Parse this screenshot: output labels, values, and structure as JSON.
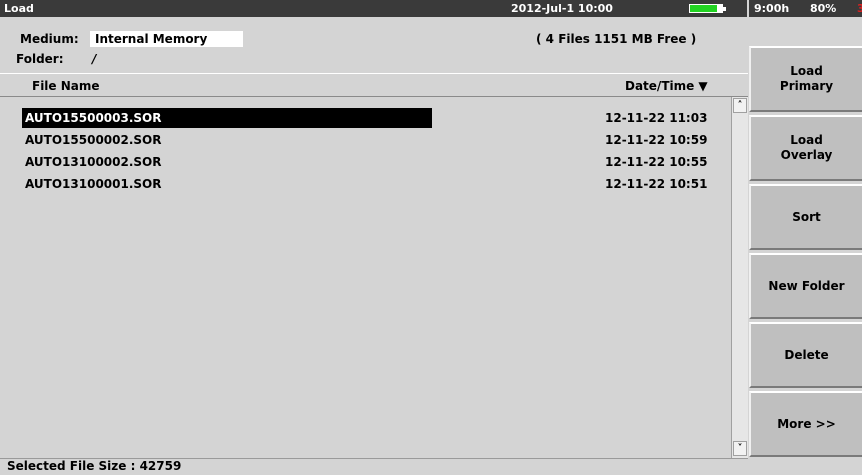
{
  "titlebar": {
    "title": "Load",
    "datetime": "2012-Jul-1 10:00",
    "battery_level": 0.85,
    "battery_color": "#22d322",
    "runtime": "9:00h",
    "percent": "80%"
  },
  "info": {
    "medium_label": "Medium:",
    "medium_value": "Internal Memory",
    "folder_label": "Folder:",
    "folder_value": "/",
    "summary": "( 4 Files   1151 MB Free )"
  },
  "columns": {
    "name": "File Name",
    "date": "Date/Time ▼"
  },
  "files": [
    {
      "name": "AUTO15500003.SOR",
      "date": "12-11-22 11:03",
      "selected": true
    },
    {
      "name": "AUTO15500002.SOR",
      "date": "12-11-22 10:59",
      "selected": false
    },
    {
      "name": "AUTO13100002.SOR",
      "date": "12-11-22 10:55",
      "selected": false
    },
    {
      "name": "AUTO13100001.SOR",
      "date": "12-11-22 10:51",
      "selected": false
    }
  ],
  "softkeys": [
    {
      "id": "load-primary",
      "label": "Load\nPrimary"
    },
    {
      "id": "load-overlay",
      "label": "Load\nOverlay"
    },
    {
      "id": "sort",
      "label": "Sort"
    },
    {
      "id": "new-folder",
      "label": "New Folder"
    },
    {
      "id": "delete",
      "label": "Delete"
    },
    {
      "id": "more",
      "label": "More >>"
    }
  ],
  "status": "Selected File Size : 42759",
  "scroll": {
    "up_icon": "˄",
    "down_icon": "˅"
  }
}
